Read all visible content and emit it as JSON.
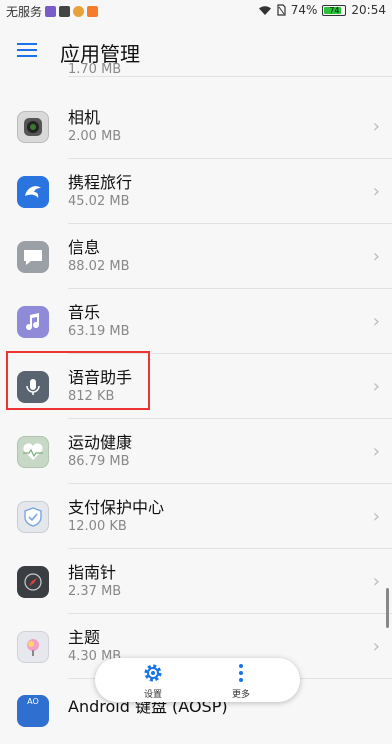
{
  "status_bar": {
    "carrier": "无服务",
    "battery": "74%",
    "battery_level": "74",
    "time": "20:54"
  },
  "header": {
    "title": "应用管理"
  },
  "list": {
    "partial_size": "1.70 MB",
    "items": [
      {
        "name": "相机",
        "size": "2.00 MB",
        "icon": "camera-icon"
      },
      {
        "name": "携程旅行",
        "size": "45.02 MB",
        "icon": "ctrip-dolphin-icon"
      },
      {
        "name": "信息",
        "size": "88.02 MB",
        "icon": "message-bubble-icon"
      },
      {
        "name": "音乐",
        "size": "63.19 MB",
        "icon": "music-note-icon"
      },
      {
        "name": "语音助手",
        "size": "812 KB",
        "icon": "microphone-icon"
      },
      {
        "name": "运动健康",
        "size": "86.79 MB",
        "icon": "heart-pulse-icon"
      },
      {
        "name": "支付保护中心",
        "size": "12.00 KB",
        "icon": "shield-check-icon"
      },
      {
        "name": "指南针",
        "size": "2.37 MB",
        "icon": "compass-icon"
      },
      {
        "name": "主题",
        "size": "4.30 MB",
        "icon": "theme-brush-icon"
      },
      {
        "name": "Android 键盘 (AOSP)",
        "size": "",
        "icon": "aosp-keyboard-icon"
      }
    ]
  },
  "bottom_bar": {
    "settings_label": "设置",
    "more_label": "更多"
  }
}
